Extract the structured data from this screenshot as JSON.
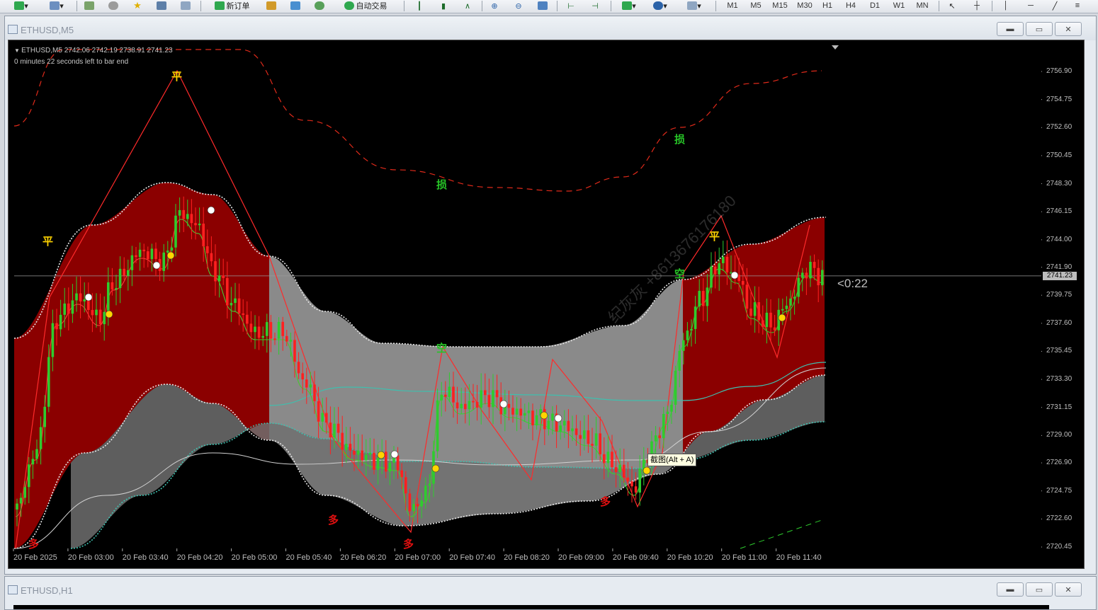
{
  "toolbar": {
    "new_order_label": "新订单",
    "auto_trade_label": "自动交易",
    "timeframes": [
      "M1",
      "M5",
      "M15",
      "M30",
      "H1",
      "H4",
      "D1",
      "W1",
      "MN"
    ]
  },
  "window_main": {
    "title": "ETHUSD,M5",
    "symbol_info": "ETHUSD,M5  2742.06 2742.19 2738.91 2741.23",
    "countdown_info": "0 minutes 22 seconds left to bar end",
    "countdown_label": "<0:22",
    "current_price": "2741.23",
    "screenshot_tooltip": "截图(Alt + A)",
    "watermark": "纪灰灰 +8613676176180"
  },
  "window_second": {
    "title": "ETHUSD,H1"
  },
  "signals": {
    "long": "多",
    "short": "空",
    "close": "平",
    "stop": "损"
  },
  "colors": {
    "band_red": "#8b0000",
    "band_gray": "#8a8a8a",
    "bull": "#2ecc2e",
    "bear": "#ff2020",
    "teal": "#3fbfae",
    "signal_yellow": "#ffd400",
    "signal_green": "#27c427",
    "signal_red": "#e01010"
  },
  "chart_data": {
    "type": "candlestick",
    "symbol": "ETHUSD",
    "timeframe": "M5",
    "ylim": [
      2720.45,
      2756.9
    ],
    "y_ticks": [
      "2756.90",
      "2754.75",
      "2752.60",
      "2750.45",
      "2748.30",
      "2746.15",
      "2744.00",
      "2741.90",
      "2739.75",
      "2737.60",
      "2735.45",
      "2733.30",
      "2731.15",
      "2729.00",
      "2726.90",
      "2724.75",
      "2722.60",
      "2720.45"
    ],
    "x_ticks": [
      "20 Feb 2025",
      "20 Feb 03:00",
      "20 Feb 03:40",
      "20 Feb 04:20",
      "20 Feb 05:00",
      "20 Feb 05:40",
      "20 Feb 06:20",
      "20 Feb 07:00",
      "20 Feb 07:40",
      "20 Feb 08:20",
      "20 Feb 09:00",
      "20 Feb 09:40",
      "20 Feb 10:20",
      "20 Feb 11:00",
      "20 Feb 11:40"
    ],
    "last_close": 2741.23
  }
}
